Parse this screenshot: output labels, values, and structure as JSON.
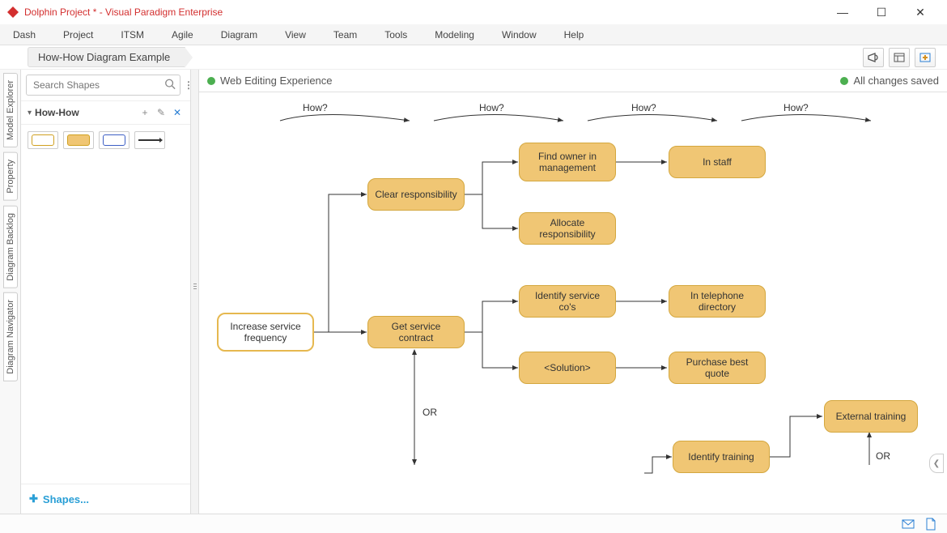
{
  "window": {
    "title": "Dolphin Project * - Visual Paradigm Enterprise",
    "minimize_label": "—",
    "maximize_label": "☐",
    "close_label": "✕"
  },
  "menu": [
    "Dash",
    "Project",
    "ITSM",
    "Agile",
    "Diagram",
    "View",
    "Team",
    "Tools",
    "Modeling",
    "Window",
    "Help"
  ],
  "breadcrumb": {
    "current": "How-How Diagram Example"
  },
  "left_panel": {
    "search_placeholder": "Search Shapes",
    "palette_title": "How-How",
    "shapes_link": "Shapes...",
    "shapes": [
      "Goal / Objective",
      "Solution",
      "Solution (alt)",
      "Arrow"
    ]
  },
  "canvas_status": {
    "left": "Web Editing Experience",
    "right": "All changes saved"
  },
  "side_tabs": [
    "Model Explorer",
    "Property",
    "Diagram Backlog",
    "Diagram Navigator"
  ],
  "diagram": {
    "how_labels": [
      "How?",
      "How?",
      "How?",
      "How?"
    ],
    "or_label": "OR",
    "or_label2": "OR",
    "nodes": {
      "root": "Increase service frequency",
      "clear_resp": "Clear responsibility",
      "get_service": "Get service contract",
      "find_owner": "Find owner in management",
      "alloc_resp": "Allocate responsibility",
      "ident_service": "Identify service co's",
      "solution_ph": "<Solution>",
      "ident_training": "Identify training",
      "in_staff": "In staff",
      "in_phone": "In telephone directory",
      "purchase": "Purchase best quote",
      "ext_training": "External training"
    }
  },
  "colors": {
    "accent": "#D32F2F",
    "node_fill": "#f0c674",
    "node_border": "#d4a73e"
  }
}
